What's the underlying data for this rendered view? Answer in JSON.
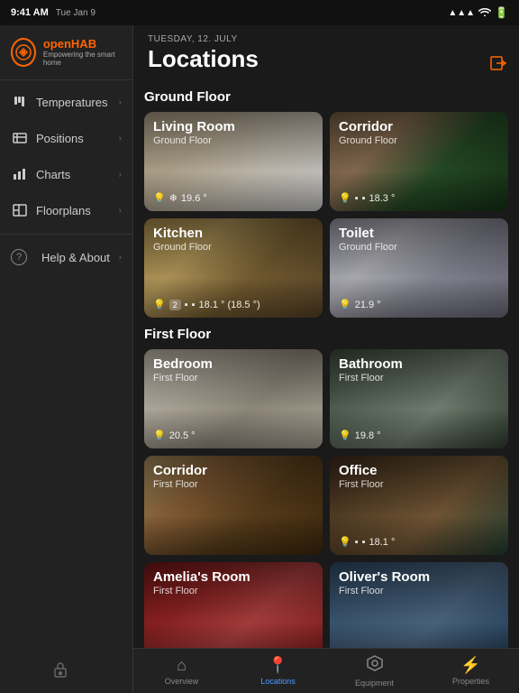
{
  "statusBar": {
    "time": "9:41 AM",
    "date": "Tue Jan 9",
    "signal": "●●●",
    "wifi": "wifi",
    "battery": "battery"
  },
  "sidebar": {
    "logo": {
      "text": "openHAB",
      "subtext": "Empowering the smart home"
    },
    "items": [
      {
        "id": "temperatures",
        "label": "Temperatures",
        "icon": "⊞"
      },
      {
        "id": "positions",
        "label": "Positions",
        "icon": "🗺"
      },
      {
        "id": "charts",
        "label": "Charts",
        "icon": "📊"
      },
      {
        "id": "floorplans",
        "label": "Floorplans",
        "icon": "⊟"
      }
    ],
    "bottomItems": [
      {
        "id": "help-about",
        "label": "Help & About",
        "icon": "?"
      }
    ]
  },
  "header": {
    "dateLabel": "TUESDAY, 12. JULY",
    "title": "Locations"
  },
  "sections": [
    {
      "id": "ground-floor",
      "title": "Ground Floor",
      "rooms": [
        {
          "id": "living-room",
          "name": "Living Room",
          "floor": "Ground Floor",
          "icons": [
            "💡",
            "❄"
          ],
          "temp": "19.6 °",
          "bgClass": "bg-living-room"
        },
        {
          "id": "corridor-gf",
          "name": "Corridor",
          "floor": "Ground Floor",
          "icons": [
            "💡",
            "🔌",
            "🔌"
          ],
          "temp": "18.3 °",
          "bgClass": "bg-corridor"
        },
        {
          "id": "kitchen",
          "name": "Kitchen",
          "floor": "Ground Floor",
          "icons": [
            "💡",
            "2",
            "🔌",
            "🔌"
          ],
          "temp": "18.1 ° (18.5 °)",
          "bgClass": "bg-kitchen"
        },
        {
          "id": "toilet",
          "name": "Toilet",
          "floor": "Ground Floor",
          "icons": [
            "💡"
          ],
          "temp": "21.9 °",
          "bgClass": "bg-toilet"
        }
      ]
    },
    {
      "id": "first-floor",
      "title": "First Floor",
      "rooms": [
        {
          "id": "bedroom",
          "name": "Bedroom",
          "floor": "First Floor",
          "icons": [
            "💡"
          ],
          "temp": "20.5 °",
          "bgClass": "bg-bedroom"
        },
        {
          "id": "bathroom",
          "name": "Bathroom",
          "floor": "First Floor",
          "icons": [
            "💡"
          ],
          "temp": "19.8 °",
          "bgClass": "bg-bathroom"
        },
        {
          "id": "corridor-ff",
          "name": "Corridor",
          "floor": "First Floor",
          "icons": [],
          "temp": "",
          "bgClass": "bg-corridor2"
        },
        {
          "id": "office",
          "name": "Office",
          "floor": "First Floor",
          "icons": [
            "💡",
            "🔌",
            "🔌"
          ],
          "temp": "18.1 °",
          "bgClass": "bg-office"
        },
        {
          "id": "amelias-room",
          "name": "Amelia's Room",
          "floor": "First Floor",
          "icons": [],
          "temp": "",
          "bgClass": "bg-amelias-room"
        },
        {
          "id": "olivers-room",
          "name": "Oliver's Room",
          "floor": "First Floor",
          "icons": [],
          "temp": "",
          "bgClass": "bg-olivers-room"
        }
      ]
    }
  ],
  "tabs": [
    {
      "id": "overview",
      "label": "Overview",
      "icon": "⌂",
      "active": false
    },
    {
      "id": "locations",
      "label": "Locations",
      "icon": "📍",
      "active": true
    },
    {
      "id": "equipment",
      "label": "Equipment",
      "icon": "⬡",
      "active": false
    },
    {
      "id": "properties",
      "label": "Properties",
      "icon": "⚡",
      "active": false
    }
  ]
}
